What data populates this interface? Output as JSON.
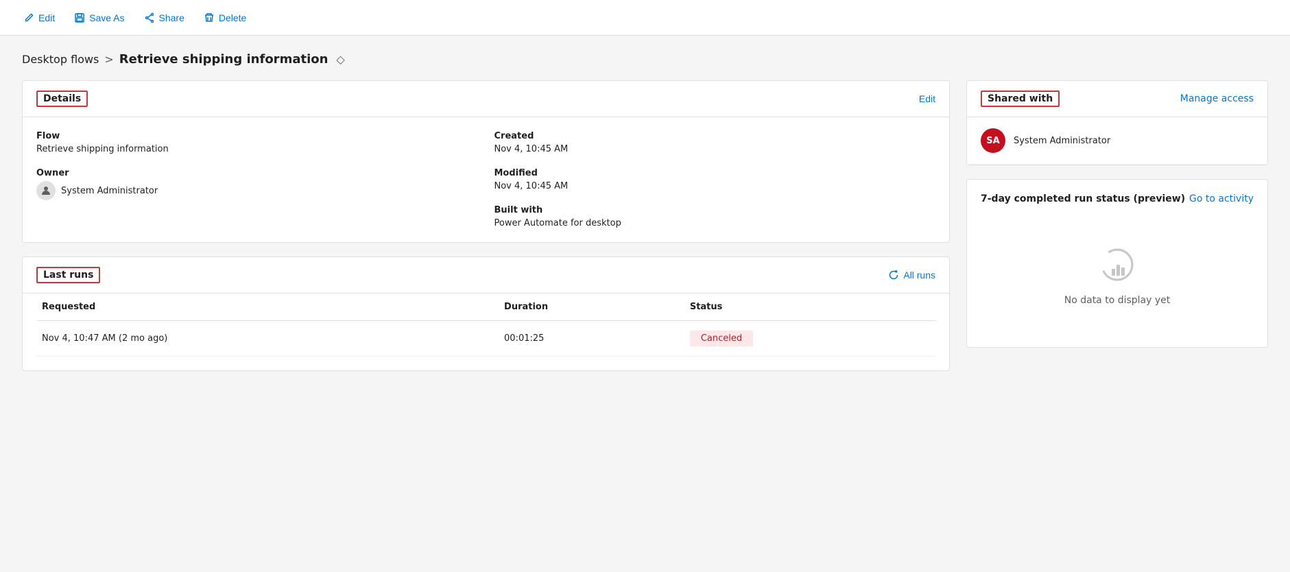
{
  "toolbar": {
    "edit_label": "Edit",
    "save_as_label": "Save As",
    "share_label": "Share",
    "delete_label": "Delete"
  },
  "breadcrumb": {
    "parent_label": "Desktop flows",
    "separator": ">",
    "current_label": "Retrieve shipping information"
  },
  "details_card": {
    "title": "Details",
    "edit_label": "Edit",
    "flow_label": "Flow",
    "flow_value": "Retrieve shipping information",
    "owner_label": "Owner",
    "owner_value": "System Administrator",
    "created_label": "Created",
    "created_value": "Nov 4, 10:45 AM",
    "modified_label": "Modified",
    "modified_value": "Nov 4, 10:45 AM",
    "built_with_label": "Built with",
    "built_with_value": "Power Automate for desktop"
  },
  "last_runs_card": {
    "title": "Last runs",
    "all_runs_label": "All runs",
    "columns": {
      "requested": "Requested",
      "duration": "Duration",
      "status": "Status"
    },
    "rows": [
      {
        "requested": "Nov 4, 10:47 AM (2 mo ago)",
        "duration": "00:01:25",
        "status": "Canceled",
        "status_type": "cancelled"
      }
    ]
  },
  "shared_with_card": {
    "title": "Shared with",
    "manage_access_label": "Manage access",
    "users": [
      {
        "initials": "SA",
        "name": "System Administrator"
      }
    ]
  },
  "run_status_section": {
    "title": "7-day completed run status (preview)",
    "go_to_activity_label": "Go to activity",
    "no_data_text": "No data to display yet"
  }
}
